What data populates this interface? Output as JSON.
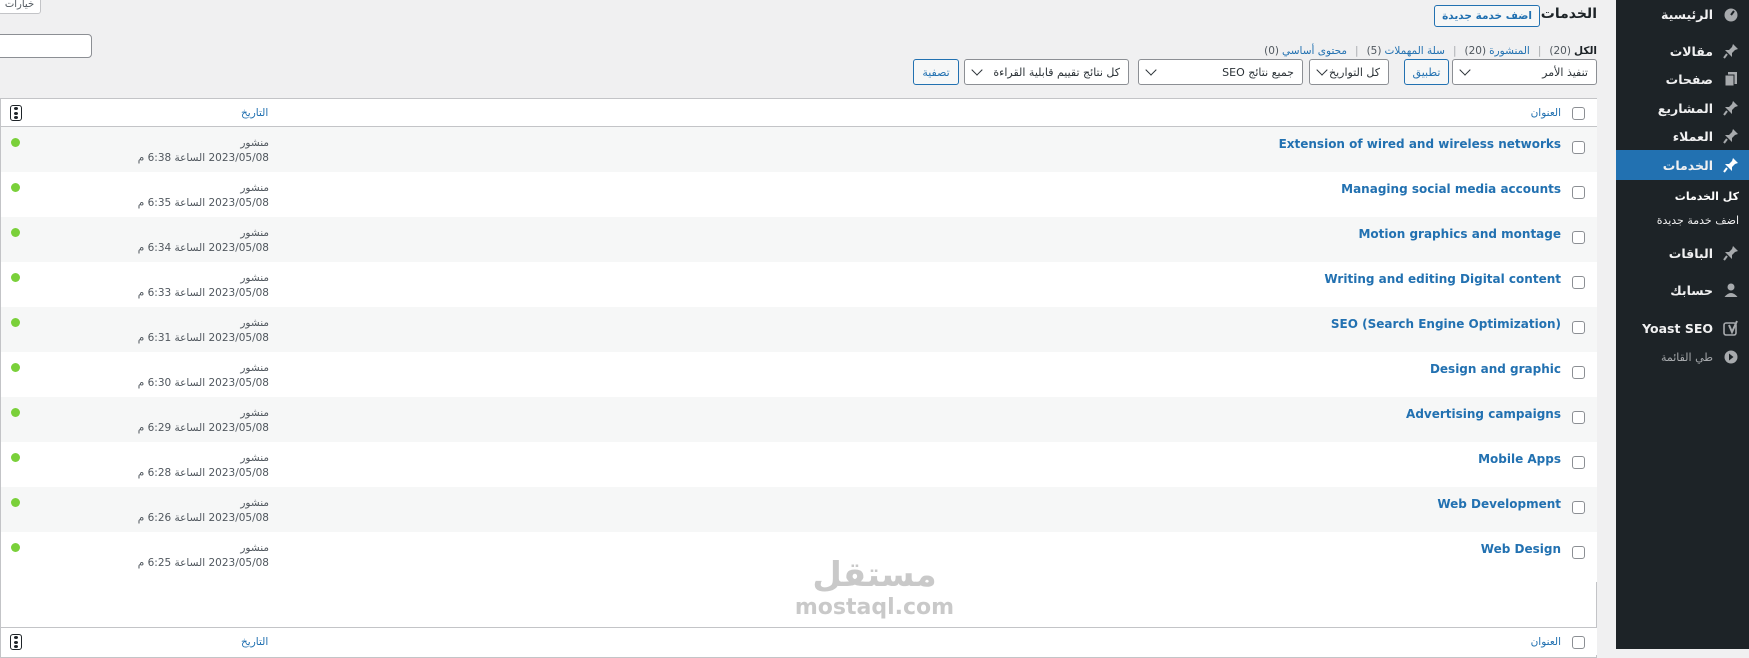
{
  "sidebar": {
    "items": [
      {
        "label": "الرئيسية",
        "icon": "dashboard-icon"
      },
      {
        "label": "مقالات",
        "icon": "pin-icon"
      },
      {
        "label": "صفحات",
        "icon": "pages-icon"
      },
      {
        "label": "المشاريع",
        "icon": "pin-icon"
      },
      {
        "label": "العملاء",
        "icon": "pin-icon"
      },
      {
        "label": "الخدمات",
        "icon": "pin-icon"
      },
      {
        "label": "الباقات",
        "icon": "pin-icon"
      },
      {
        "label": "حسابك",
        "icon": "user-icon"
      },
      {
        "label": "Yoast SEO",
        "icon": "yoast-icon"
      }
    ],
    "submenu": [
      {
        "label": "كل الخدمات"
      },
      {
        "label": "اضف خدمة جديدة"
      }
    ],
    "collapse_label": "طي القائمة",
    "accent_color": "#2271b1",
    "bg_color": "#1d2327"
  },
  "header": {
    "title": "الخدمات",
    "add_new_label": "اضف خدمة جديدة",
    "screen_options_label": "خيارات"
  },
  "filters": [
    {
      "label": "الكل",
      "count": "(20)"
    },
    {
      "label": "المنشورة",
      "count": "(20)"
    },
    {
      "label": "سلة المهملات",
      "count": "(5)"
    },
    {
      "label": "محتوى أساسي",
      "count": "(0)"
    }
  ],
  "tablenav": {
    "bulk_action": "تنفيذ الأمر",
    "apply_label": "تطبيق",
    "dates_filter": "كل التواريخ",
    "seo_filter": "جميع نتائج SEO",
    "readability_filter": "كل نتائج تقييم قابلية القراءة",
    "filter_button": "تصفية"
  },
  "table": {
    "col_title": "العنوان",
    "col_date": "التاريخ",
    "rows": [
      {
        "title": "Extension of wired and wireless networks",
        "status": "منشور",
        "date": "2023/05/08 الساعة 6:38 م",
        "seo": "good"
      },
      {
        "title": "Managing social media accounts",
        "status": "منشور",
        "date": "2023/05/08 الساعة 6:35 م",
        "seo": "good"
      },
      {
        "title": "Motion graphics and montage",
        "status": "منشور",
        "date": "2023/05/08 الساعة 6:34 م",
        "seo": "good"
      },
      {
        "title": "Writing and editing Digital content",
        "status": "منشور",
        "date": "2023/05/08 الساعة 6:33 م",
        "seo": "good"
      },
      {
        "title": "SEO (Search Engine Optimization)",
        "status": "منشور",
        "date": "2023/05/08 الساعة 6:31 م",
        "seo": "good"
      },
      {
        "title": "Design and graphic",
        "status": "منشور",
        "date": "2023/05/08 الساعة 6:30 م",
        "seo": "good"
      },
      {
        "title": "Advertising campaigns",
        "status": "منشور",
        "date": "2023/05/08 الساعة 6:29 م",
        "seo": "good"
      },
      {
        "title": "Mobile Apps",
        "status": "منشور",
        "date": "2023/05/08 الساعة 6:28 م",
        "seo": "good"
      },
      {
        "title": "Web Development",
        "status": "منشور",
        "date": "2023/05/08 الساعة 6:26 م",
        "seo": "good"
      },
      {
        "title": "Web Design",
        "status": "منشور",
        "date": "2023/05/08 الساعة 6:25 م",
        "seo": "good"
      }
    ]
  },
  "watermark": {
    "ar": "مستقل",
    "en": "mostaql.com"
  }
}
